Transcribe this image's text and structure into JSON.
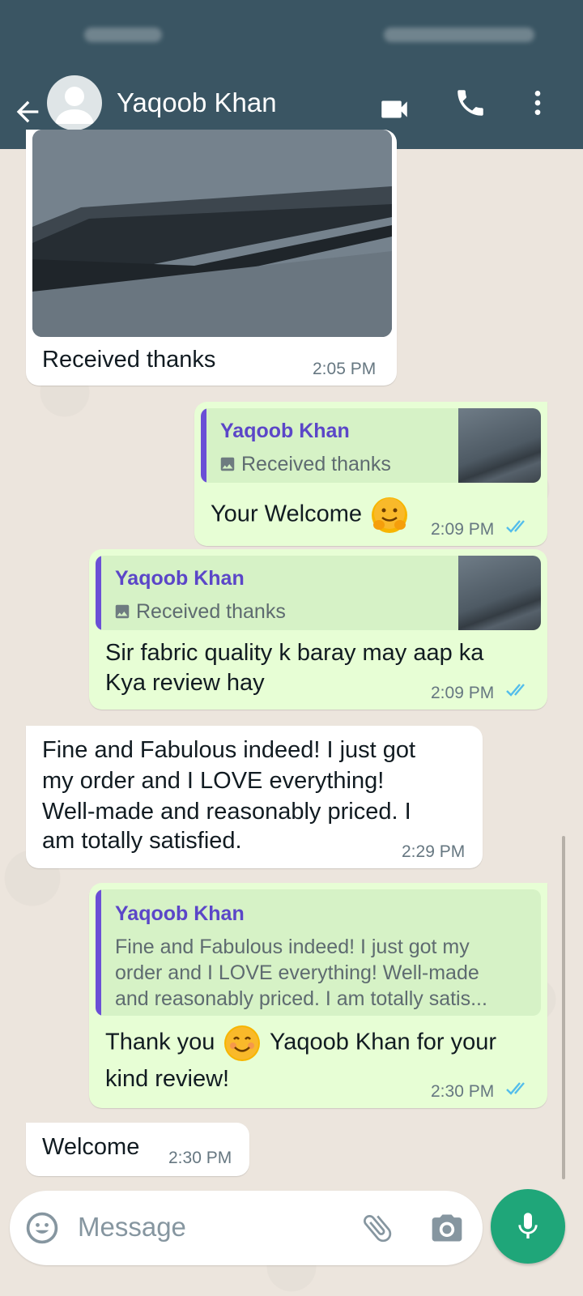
{
  "header": {
    "contact_name": "Yaqoob Khan"
  },
  "messages": [
    {
      "direction": "incoming",
      "type": "photo",
      "caption": "Received thanks",
      "time": "2:05 PM"
    },
    {
      "direction": "outgoing",
      "quote": {
        "author": "Yaqoob Khan",
        "text": "Received thanks"
      },
      "text": "Your Welcome",
      "time": "2:09 PM",
      "status": "read"
    },
    {
      "direction": "outgoing",
      "quote": {
        "author": "Yaqoob Khan",
        "text": "Received thanks"
      },
      "text_lines": [
        "Sir fabric quality k baray may aap ka",
        "Kya review hay"
      ],
      "time": "2:09 PM",
      "status": "read"
    },
    {
      "direction": "incoming",
      "text_lines": [
        "Fine and Fabulous indeed! I just got",
        "my order and I LOVE everything!",
        "Well-made and reasonably priced. I",
        "am totally satisfied."
      ],
      "time": "2:29 PM"
    },
    {
      "direction": "outgoing",
      "quote": {
        "author": "Yaqoob Khan",
        "text_lines": [
          "Fine and Fabulous indeed! I just got my",
          "order and I LOVE everything! Well-made",
          "and reasonably priced. I am totally satis..."
        ]
      },
      "text_lines": [
        "Thank you",
        "Yaqoob Khan for your",
        "kind review!"
      ],
      "time": "2:30 PM",
      "status": "read"
    },
    {
      "direction": "incoming",
      "text": "Welcome",
      "time": "2:30 PM"
    }
  ],
  "composer": {
    "placeholder": "Message"
  },
  "colors": {
    "header": "#3a5563",
    "outgoing_bubble": "#e7fed5",
    "incoming_bubble": "#ffffff",
    "accent": "#1fa679",
    "read_ticks": "#53bdeb",
    "quote_author": "#5b46c8"
  },
  "icons": [
    "back-arrow-icon",
    "avatar-icon",
    "video-call-icon",
    "phone-icon",
    "more-vert-icon",
    "image-icon",
    "double-check-icon",
    "emoji-icon",
    "attach-icon",
    "camera-icon",
    "mic-icon"
  ]
}
